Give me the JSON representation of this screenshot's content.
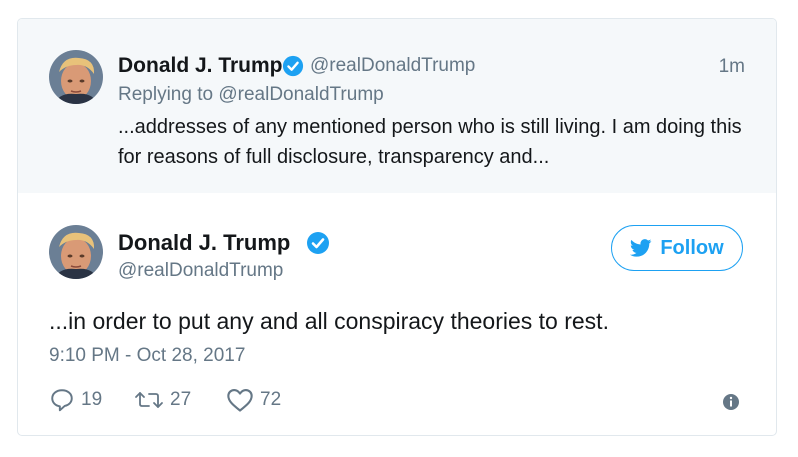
{
  "parent_tweet": {
    "author_name": "Donald J. Trump",
    "handle": "@realDonaldTrump",
    "time_ago": "1m",
    "replying_prefix": "Replying to",
    "replying_to": "@realDonaldTrump",
    "text": "...addresses of any mentioned person who is still living. I am doing this for reasons of full disclosure, transparency and..."
  },
  "tweet": {
    "author_name": "Donald J. Trump",
    "handle": "@realDonaldTrump",
    "follow_label": "Follow",
    "text": "...in order to put any and all conspiracy theories to rest.",
    "timestamp": "9:10 PM - Oct 28, 2017",
    "reply_count": "19",
    "retweet_count": "27",
    "like_count": "72"
  },
  "colors": {
    "accent": "#1da1f2",
    "secondary_text": "#657786",
    "primary_text": "#14171a",
    "parent_background": "#f5f8fa",
    "border": "#e1e8ed"
  },
  "icons": {
    "verified": "verified-badge-icon",
    "follow": "twitter-bird-icon",
    "reply": "reply-icon",
    "retweet": "retweet-icon",
    "like": "heart-icon",
    "info": "info-icon"
  }
}
